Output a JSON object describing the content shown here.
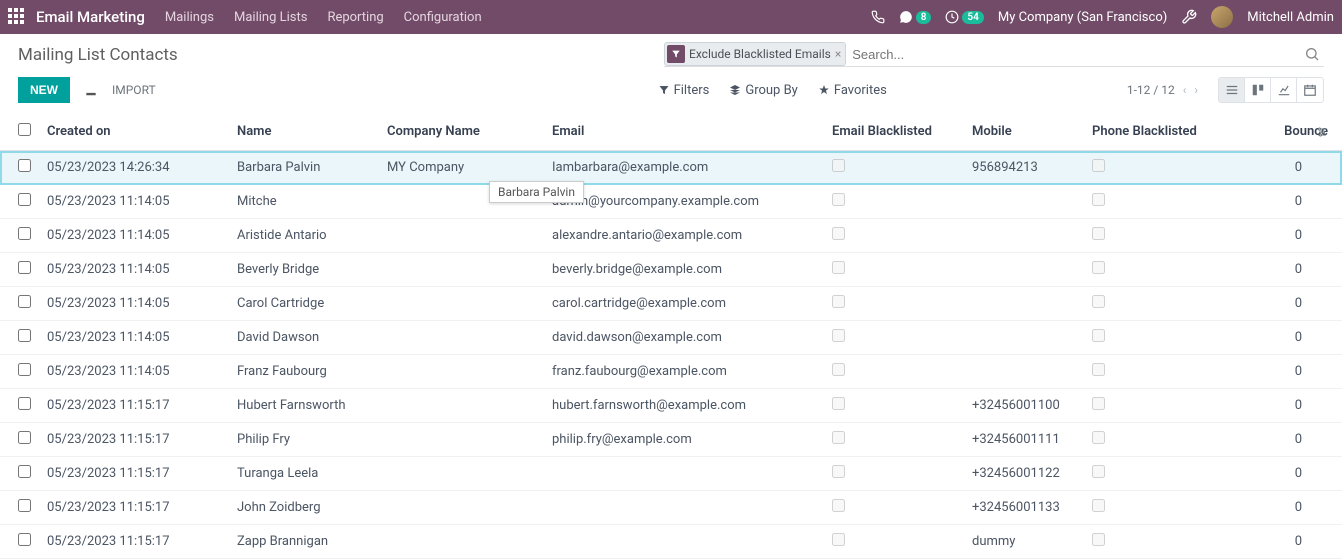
{
  "top": {
    "app_title": "Email Marketing",
    "nav": [
      "Mailings",
      "Mailing Lists",
      "Reporting",
      "Configuration"
    ],
    "msg_badge": "8",
    "activity_badge": "54",
    "company": "My Company (San Francisco)",
    "user": "Mitchell Admin"
  },
  "page_title": "Mailing List Contacts",
  "filter_chip": "Exclude Blacklisted Emails",
  "search_placeholder": "Search...",
  "buttons": {
    "new": "NEW",
    "import": "IMPORT"
  },
  "toolbar": {
    "filters": "Filters",
    "groupby": "Group By",
    "favorites": "Favorites"
  },
  "pager": "1-12 / 12",
  "headers": {
    "created": "Created on",
    "name": "Name",
    "company": "Company Name",
    "email": "Email",
    "eblk": "Email Blacklisted",
    "mobile": "Mobile",
    "pblk": "Phone Blacklisted",
    "bounce": "Bounce"
  },
  "tooltip": "Barbara Palvin",
  "rows": [
    {
      "created": "05/23/2023 14:26:34",
      "name": "Barbara Palvin",
      "company": "MY Company",
      "email": "Iambarbara@example.com",
      "mobile": "956894213",
      "bounce": "0",
      "hl": true
    },
    {
      "created": "05/23/2023 11:14:05",
      "name": "Mitche",
      "company": "",
      "email": "admin@yourcompany.example.com",
      "mobile": "",
      "bounce": "0"
    },
    {
      "created": "05/23/2023 11:14:05",
      "name": "Aristide Antario",
      "company": "",
      "email": "alexandre.antario@example.com",
      "mobile": "",
      "bounce": "0"
    },
    {
      "created": "05/23/2023 11:14:05",
      "name": "Beverly Bridge",
      "company": "",
      "email": "beverly.bridge@example.com",
      "mobile": "",
      "bounce": "0"
    },
    {
      "created": "05/23/2023 11:14:05",
      "name": "Carol Cartridge",
      "company": "",
      "email": "carol.cartridge@example.com",
      "mobile": "",
      "bounce": "0"
    },
    {
      "created": "05/23/2023 11:14:05",
      "name": "David Dawson",
      "company": "",
      "email": "david.dawson@example.com",
      "mobile": "",
      "bounce": "0"
    },
    {
      "created": "05/23/2023 11:14:05",
      "name": "Franz Faubourg",
      "company": "",
      "email": "franz.faubourg@example.com",
      "mobile": "",
      "bounce": "0"
    },
    {
      "created": "05/23/2023 11:15:17",
      "name": "Hubert Farnsworth",
      "company": "",
      "email": "hubert.farnsworth@example.com",
      "mobile": "+32456001100",
      "bounce": "0"
    },
    {
      "created": "05/23/2023 11:15:17",
      "name": "Philip Fry",
      "company": "",
      "email": "philip.fry@example.com",
      "mobile": "+32456001111",
      "bounce": "0"
    },
    {
      "created": "05/23/2023 11:15:17",
      "name": "Turanga Leela",
      "company": "",
      "email": "",
      "mobile": "+32456001122",
      "bounce": "0"
    },
    {
      "created": "05/23/2023 11:15:17",
      "name": "John Zoidberg",
      "company": "",
      "email": "",
      "mobile": "+32456001133",
      "bounce": "0"
    },
    {
      "created": "05/23/2023 11:15:17",
      "name": "Zapp Brannigan",
      "company": "",
      "email": "",
      "mobile": "dummy",
      "bounce": "0"
    }
  ]
}
